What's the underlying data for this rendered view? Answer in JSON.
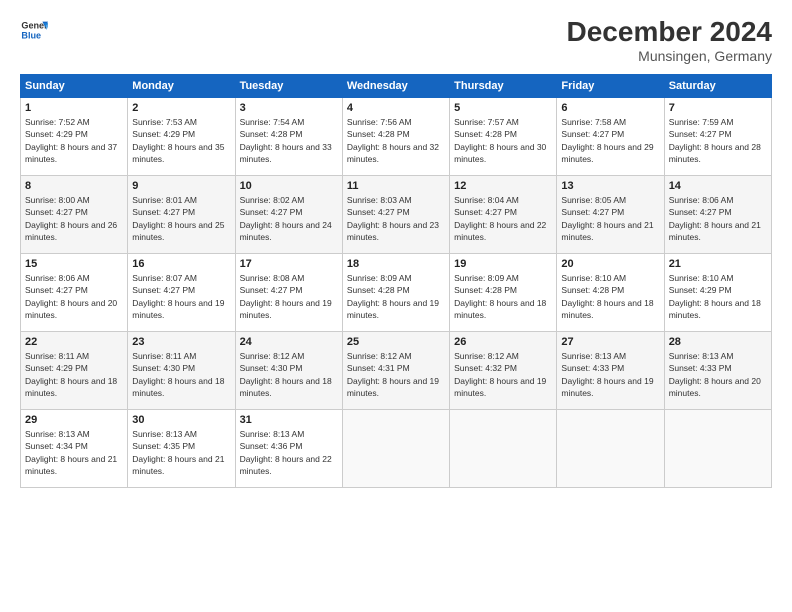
{
  "header": {
    "logo_line1": "General",
    "logo_line2": "Blue",
    "month": "December 2024",
    "location": "Munsingen, Germany"
  },
  "days_of_week": [
    "Sunday",
    "Monday",
    "Tuesday",
    "Wednesday",
    "Thursday",
    "Friday",
    "Saturday"
  ],
  "weeks": [
    [
      {
        "day": "1",
        "sunrise": "7:52 AM",
        "sunset": "4:29 PM",
        "daylight": "8 hours and 37 minutes."
      },
      {
        "day": "2",
        "sunrise": "7:53 AM",
        "sunset": "4:29 PM",
        "daylight": "8 hours and 35 minutes."
      },
      {
        "day": "3",
        "sunrise": "7:54 AM",
        "sunset": "4:28 PM",
        "daylight": "8 hours and 33 minutes."
      },
      {
        "day": "4",
        "sunrise": "7:56 AM",
        "sunset": "4:28 PM",
        "daylight": "8 hours and 32 minutes."
      },
      {
        "day": "5",
        "sunrise": "7:57 AM",
        "sunset": "4:28 PM",
        "daylight": "8 hours and 30 minutes."
      },
      {
        "day": "6",
        "sunrise": "7:58 AM",
        "sunset": "4:27 PM",
        "daylight": "8 hours and 29 minutes."
      },
      {
        "day": "7",
        "sunrise": "7:59 AM",
        "sunset": "4:27 PM",
        "daylight": "8 hours and 28 minutes."
      }
    ],
    [
      {
        "day": "8",
        "sunrise": "8:00 AM",
        "sunset": "4:27 PM",
        "daylight": "8 hours and 26 minutes."
      },
      {
        "day": "9",
        "sunrise": "8:01 AM",
        "sunset": "4:27 PM",
        "daylight": "8 hours and 25 minutes."
      },
      {
        "day": "10",
        "sunrise": "8:02 AM",
        "sunset": "4:27 PM",
        "daylight": "8 hours and 24 minutes."
      },
      {
        "day": "11",
        "sunrise": "8:03 AM",
        "sunset": "4:27 PM",
        "daylight": "8 hours and 23 minutes."
      },
      {
        "day": "12",
        "sunrise": "8:04 AM",
        "sunset": "4:27 PM",
        "daylight": "8 hours and 22 minutes."
      },
      {
        "day": "13",
        "sunrise": "8:05 AM",
        "sunset": "4:27 PM",
        "daylight": "8 hours and 21 minutes."
      },
      {
        "day": "14",
        "sunrise": "8:06 AM",
        "sunset": "4:27 PM",
        "daylight": "8 hours and 21 minutes."
      }
    ],
    [
      {
        "day": "15",
        "sunrise": "8:06 AM",
        "sunset": "4:27 PM",
        "daylight": "8 hours and 20 minutes."
      },
      {
        "day": "16",
        "sunrise": "8:07 AM",
        "sunset": "4:27 PM",
        "daylight": "8 hours and 19 minutes."
      },
      {
        "day": "17",
        "sunrise": "8:08 AM",
        "sunset": "4:27 PM",
        "daylight": "8 hours and 19 minutes."
      },
      {
        "day": "18",
        "sunrise": "8:09 AM",
        "sunset": "4:28 PM",
        "daylight": "8 hours and 19 minutes."
      },
      {
        "day": "19",
        "sunrise": "8:09 AM",
        "sunset": "4:28 PM",
        "daylight": "8 hours and 18 minutes."
      },
      {
        "day": "20",
        "sunrise": "8:10 AM",
        "sunset": "4:28 PM",
        "daylight": "8 hours and 18 minutes."
      },
      {
        "day": "21",
        "sunrise": "8:10 AM",
        "sunset": "4:29 PM",
        "daylight": "8 hours and 18 minutes."
      }
    ],
    [
      {
        "day": "22",
        "sunrise": "8:11 AM",
        "sunset": "4:29 PM",
        "daylight": "8 hours and 18 minutes."
      },
      {
        "day": "23",
        "sunrise": "8:11 AM",
        "sunset": "4:30 PM",
        "daylight": "8 hours and 18 minutes."
      },
      {
        "day": "24",
        "sunrise": "8:12 AM",
        "sunset": "4:30 PM",
        "daylight": "8 hours and 18 minutes."
      },
      {
        "day": "25",
        "sunrise": "8:12 AM",
        "sunset": "4:31 PM",
        "daylight": "8 hours and 19 minutes."
      },
      {
        "day": "26",
        "sunrise": "8:12 AM",
        "sunset": "4:32 PM",
        "daylight": "8 hours and 19 minutes."
      },
      {
        "day": "27",
        "sunrise": "8:13 AM",
        "sunset": "4:33 PM",
        "daylight": "8 hours and 19 minutes."
      },
      {
        "day": "28",
        "sunrise": "8:13 AM",
        "sunset": "4:33 PM",
        "daylight": "8 hours and 20 minutes."
      }
    ],
    [
      {
        "day": "29",
        "sunrise": "8:13 AM",
        "sunset": "4:34 PM",
        "daylight": "8 hours and 21 minutes."
      },
      {
        "day": "30",
        "sunrise": "8:13 AM",
        "sunset": "4:35 PM",
        "daylight": "8 hours and 21 minutes."
      },
      {
        "day": "31",
        "sunrise": "8:13 AM",
        "sunset": "4:36 PM",
        "daylight": "8 hours and 22 minutes."
      },
      null,
      null,
      null,
      null
    ]
  ]
}
